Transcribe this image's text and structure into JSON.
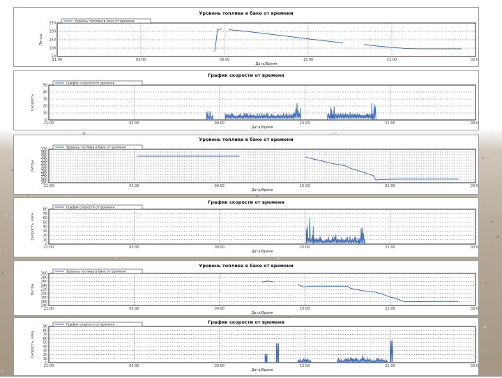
{
  "colors": {
    "series": "#3f6fb8",
    "grid": "#6f6f6f",
    "frame": "#222222"
  },
  "chart_data": [
    {
      "type": "line",
      "title": "Уровень топлива в баке от времени",
      "xlabel": "Дата/Время",
      "ylabel": "Литры",
      "legend": "Уровень топлива в баке от времени",
      "xticks": [
        "21:00",
        "03:00",
        "09:00",
        "15:00",
        "21:00",
        "03:00"
      ],
      "yticks": [
        "250",
        "200",
        "150",
        "100",
        "50"
      ],
      "xlim": [
        0,
        30
      ],
      "ylim": [
        50,
        250
      ],
      "grid": true,
      "series": [
        {
          "segments": [
            [
              [
                11.3,
                80
              ],
              [
                11.5,
                210
              ],
              [
                11.8,
                215
              ]
            ],
            [
              [
                12.3,
                210
              ],
              [
                13.0,
                205
              ],
              [
                14.0,
                196
              ],
              [
                15.0,
                186
              ],
              [
                16.0,
                176
              ],
              [
                17.0,
                166
              ],
              [
                18.0,
                155
              ],
              [
                19.0,
                146
              ],
              [
                20.0,
                136
              ],
              [
                20.5,
                131
              ]
            ],
            [
              [
                22.0,
                122
              ],
              [
                23.0,
                112
              ],
              [
                24.0,
                104
              ],
              [
                25.0,
                98
              ],
              [
                26.0,
                96
              ],
              [
                27.0,
                96
              ],
              [
                28.0,
                96
              ],
              [
                29.0,
                96
              ]
            ]
          ]
        }
      ]
    },
    {
      "type": "line",
      "title": "График скорости от времени",
      "xlabel": "Дата/Время",
      "ylabel": "Скорость",
      "legend": "График скорости от времени",
      "xticks": [
        "21:00",
        "03:00",
        "09:00",
        "15:00",
        "21:00",
        "03:00"
      ],
      "yticks": [
        "50",
        "40",
        "30",
        "20",
        "10",
        "0"
      ],
      "xlim": [
        0,
        30
      ],
      "ylim": [
        0,
        50
      ],
      "grid": true,
      "series": [
        {
          "bursts": [
            {
              "start": 11.1,
              "end": 11.5,
              "base": 4,
              "peak": 18
            },
            {
              "start": 12.4,
              "end": 17.2,
              "base": 6,
              "peak": 12
            },
            {
              "start": 17.2,
              "end": 17.7,
              "base": 8,
              "peak": 24
            },
            {
              "start": 19.6,
              "end": 22.8,
              "base": 7,
              "peak": 11
            },
            {
              "start": 19.8,
              "end": 20.1,
              "base": 5,
              "peak": 33
            },
            {
              "start": 22.7,
              "end": 23.0,
              "base": 5,
              "peak": 35
            }
          ]
        }
      ]
    },
    {
      "type": "line",
      "title": "Уровень топлива в баке от времени",
      "xlabel": "Дата/Время",
      "ylabel": "Литры",
      "legend": "Уровень топлива в баке от времени",
      "xticks": [
        "21:00",
        "03:00",
        "09:00",
        "15:00",
        "21:00",
        "03:00"
      ],
      "yticks": [
        "370",
        "360",
        "350",
        "340",
        "330",
        "320",
        "310",
        "300",
        "290",
        "280",
        "270",
        "260",
        "250"
      ],
      "xlim": [
        0,
        30
      ],
      "ylim": [
        250,
        370
      ],
      "grid": true,
      "series": [
        {
          "segments": [
            [
              [
                6.2,
                345
              ],
              [
                13.4,
                345
              ]
            ],
            [
              [
                18.0,
                343
              ],
              [
                18.6,
                335
              ],
              [
                19.2,
                328
              ],
              [
                20.0,
                318
              ],
              [
                20.8,
                312
              ],
              [
                21.4,
                298
              ],
              [
                22.0,
                290
              ],
              [
                22.4,
                282
              ],
              [
                22.8,
                276
              ],
              [
                23.0,
                260
              ],
              [
                23.5,
                262
              ],
              [
                24.5,
                263
              ],
              [
                26.0,
                263
              ],
              [
                27.5,
                263
              ],
              [
                28.8,
                263
              ]
            ]
          ]
        }
      ]
    },
    {
      "type": "line",
      "title": "График скорости от времени",
      "xlabel": "Дата/Время",
      "ylabel": "Скорость, км/ч",
      "legend": "График скорости от времени",
      "xticks": [
        "21:00",
        "03:00",
        "09:00",
        "15:00",
        "21:00",
        "03:00"
      ],
      "yticks": [
        "80",
        "70",
        "60",
        "50",
        "40",
        "30",
        "20",
        "10",
        "0"
      ],
      "xlim": [
        0,
        30
      ],
      "ylim": [
        0,
        80
      ],
      "grid": true,
      "series": [
        {
          "bursts": [
            {
              "start": 18.1,
              "end": 18.6,
              "base": 10,
              "peak": 60
            },
            {
              "start": 18.6,
              "end": 21.8,
              "base": 8,
              "peak": 22
            },
            {
              "start": 21.8,
              "end": 22.2,
              "base": 6,
              "peak": 62
            }
          ]
        }
      ]
    },
    {
      "type": "line",
      "title": "Уровень топлива в баке от времени",
      "xlabel": "Дата/Время",
      "ylabel": "Литры",
      "legend": "Уровень топлива в баке от времени",
      "xticks": [
        "21:00",
        "03:00",
        "09:00",
        "15:00",
        "21:00",
        "03:00"
      ],
      "yticks": [
        "300",
        "280",
        "260",
        "240",
        "220",
        "200",
        "180",
        "160",
        "140"
      ],
      "xlim": [
        0,
        30
      ],
      "ylim": [
        140,
        300
      ],
      "grid": true,
      "series": [
        {
          "segments": [
            [
              [
                15.0,
                256
              ],
              [
                15.4,
                262
              ],
              [
                15.8,
                258
              ]
            ],
            [
              [
                17.5,
                244
              ],
              [
                17.9,
                232
              ],
              [
                18.4,
                236
              ],
              [
                19.0,
                236
              ],
              [
                20.0,
                236
              ],
              [
                21.0,
                236
              ],
              [
                21.2,
                226
              ],
              [
                22.0,
                214
              ],
              [
                23.0,
                206
              ],
              [
                23.5,
                195
              ],
              [
                24.0,
                182
              ],
              [
                24.6,
                170
              ],
              [
                25.0,
                158
              ],
              [
                26.0,
                159
              ],
              [
                27.5,
                160
              ],
              [
                28.8,
                160
              ]
            ]
          ]
        }
      ]
    },
    {
      "type": "line",
      "title": "График скорости от времени",
      "xlabel": "Дата/Время",
      "ylabel": "Скорость, км/ч",
      "legend": "График скорости от времени",
      "xticks": [
        "21:00",
        "03:00",
        "09:00",
        "15:00",
        "21:00",
        "03:00"
      ],
      "yticks": [
        "90",
        "80",
        "70",
        "60",
        "50",
        "40",
        "30",
        "20",
        "10",
        "0"
      ],
      "xlim": [
        0,
        30
      ],
      "ylim": [
        0,
        90
      ],
      "grid": true,
      "series": [
        {
          "bursts": [
            {
              "start": 15.2,
              "end": 15.35,
              "base": 0,
              "peak": 22
            },
            {
              "start": 16.0,
              "end": 16.15,
              "base": 0,
              "peak": 48
            },
            {
              "start": 17.5,
              "end": 18.4,
              "base": 4,
              "peak": 14
            },
            {
              "start": 20.3,
              "end": 23.8,
              "base": 4,
              "peak": 18
            },
            {
              "start": 24.0,
              "end": 24.2,
              "base": 6,
              "peak": 55
            }
          ]
        }
      ]
    }
  ]
}
